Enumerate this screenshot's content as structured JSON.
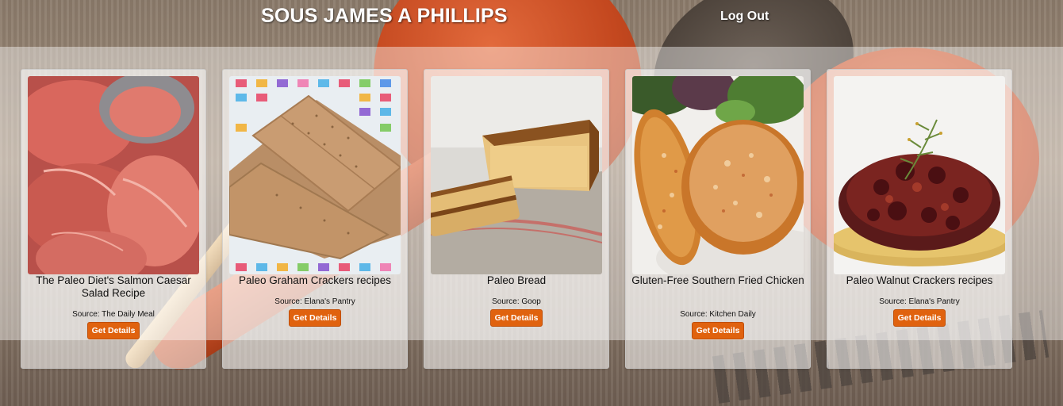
{
  "header": {
    "brand": "SOUS JAMES A PHILLIPS",
    "logout_label": "Log Out"
  },
  "colors": {
    "button": "#e0620e",
    "band": "#ffffff"
  },
  "recipes": [
    {
      "title": "The Paleo Diet's Salmon Caesar Salad Recipe",
      "source": "Source: The Daily Meal",
      "button": "Get Details",
      "image": "salmon-steaks"
    },
    {
      "title": "Paleo Graham Crackers recipes",
      "source": "Source: Elana's Pantry",
      "button": "Get Details",
      "image": "graham-crackers"
    },
    {
      "title": "Paleo Bread",
      "source": "Source: Goop",
      "button": "Get Details",
      "image": "bread-loaf"
    },
    {
      "title": "Gluten-Free Southern Fried Chicken",
      "source": "Source: Kitchen Daily",
      "button": "Get Details",
      "image": "fried-chicken"
    },
    {
      "title": "Paleo Walnut Crackers recipes",
      "source": "Source: Elana's Pantry",
      "button": "Get Details",
      "image": "walnut-crackers"
    }
  ]
}
